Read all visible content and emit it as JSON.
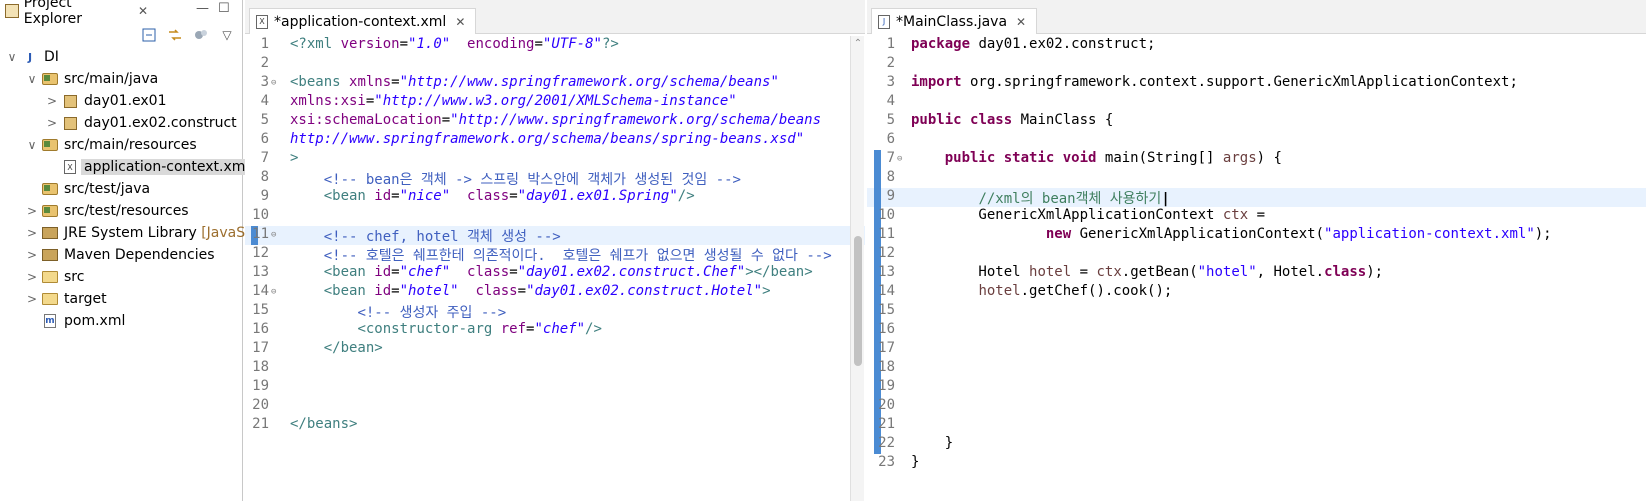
{
  "explorer": {
    "tab_label": "Project Explorer",
    "close_glyph": "✕",
    "minimize_glyph": "—",
    "maximize_glyph": "☐",
    "toolbar": {
      "collapse_all_icon": "collapse-all-icon",
      "link_editor_icon": "link-with-editor-icon",
      "filters_icon": "filters-icon",
      "menu_icon": "view-menu-icon",
      "menu_glyph": "▽"
    },
    "tree": [
      {
        "label": "DI",
        "icon": "project-icon",
        "arrow": "∨"
      },
      {
        "label": "src/main/java",
        "icon": "source-folder-icon",
        "arrow": "∨"
      },
      {
        "label": "day01.ex01",
        "icon": "package-icon",
        "arrow": ">"
      },
      {
        "label": "day01.ex02.construct",
        "icon": "package-icon",
        "arrow": ">"
      },
      {
        "label": "src/main/resources",
        "icon": "source-folder-icon",
        "arrow": "∨"
      },
      {
        "label": "application-context.xml",
        "icon": "xml-file-icon",
        "arrow": ""
      },
      {
        "label": "src/test/java",
        "icon": "source-folder-icon",
        "arrow": ""
      },
      {
        "label": "src/test/resources",
        "icon": "source-folder-icon",
        "arrow": ">"
      },
      {
        "label": "JRE System Library",
        "decoration": "[JavaSE-",
        "icon": "library-icon",
        "arrow": ">"
      },
      {
        "label": "Maven Dependencies",
        "icon": "library-icon",
        "arrow": ">"
      },
      {
        "label": "src",
        "icon": "folder-icon",
        "arrow": ">"
      },
      {
        "label": "target",
        "icon": "folder-icon",
        "arrow": ">"
      },
      {
        "label": "pom.xml",
        "icon": "maven-file-icon",
        "arrow": ""
      }
    ]
  },
  "xml_editor": {
    "tab_label": "*application-context.xml",
    "close_glyph": "✕",
    "lines": [
      {
        "n": "1",
        "tokens": [
          [
            "xml-tag",
            "<?xml "
          ],
          [
            "xml-attr",
            "version"
          ],
          [
            "",
            "="
          ],
          [
            "xml-val",
            "\"1.0\""
          ],
          [
            "",
            "  "
          ],
          [
            "xml-attr",
            "encoding"
          ],
          [
            "",
            "="
          ],
          [
            "xml-val",
            "\"UTF-8\""
          ],
          [
            "xml-tag",
            "?>"
          ]
        ]
      },
      {
        "n": "2",
        "tokens": []
      },
      {
        "n": "3",
        "fold": true,
        "tokens": [
          [
            "xml-tag",
            "<beans "
          ],
          [
            "xml-attr",
            "xmlns"
          ],
          [
            "",
            "="
          ],
          [
            "xml-val",
            "\"http://www.springframework.org/schema/beans\""
          ]
        ]
      },
      {
        "n": "4",
        "tokens": [
          [
            "xml-attr",
            "xmlns:xsi"
          ],
          [
            "",
            "="
          ],
          [
            "xml-val",
            "\"http://www.w3.org/2001/XMLSchema-instance\""
          ]
        ]
      },
      {
        "n": "5",
        "tokens": [
          [
            "xml-attr",
            "xsi:schemaLocation"
          ],
          [
            "",
            "="
          ],
          [
            "xml-val",
            "\"http://www.springframework.org/schema/beans"
          ]
        ]
      },
      {
        "n": "6",
        "tokens": [
          [
            "xml-val",
            "http://www.springframework.org/schema/beans/spring-beans.xsd\""
          ]
        ]
      },
      {
        "n": "7",
        "tokens": [
          [
            "xml-tag",
            ">"
          ]
        ]
      },
      {
        "n": "8",
        "tokens": [
          [
            "",
            "    "
          ],
          [
            "xml-cmt",
            "<!-- bean은 객체 -> 스프링 박스안에 객체가 생성된 것임 -->"
          ]
        ]
      },
      {
        "n": "9",
        "tokens": [
          [
            "",
            "    "
          ],
          [
            "xml-tag",
            "<bean "
          ],
          [
            "xml-attr",
            "id"
          ],
          [
            "",
            "="
          ],
          [
            "xml-val",
            "\"nice\""
          ],
          [
            "",
            "  "
          ],
          [
            "xml-attr",
            "class"
          ],
          [
            "",
            "="
          ],
          [
            "xml-val",
            "\"day01.ex01.Spring\""
          ],
          [
            "xml-tag",
            "/>"
          ]
        ]
      },
      {
        "n": "10",
        "tokens": []
      },
      {
        "n": "11",
        "fold": true,
        "current": true,
        "tokens": [
          [
            "",
            "    "
          ],
          [
            "xml-cmt",
            "<!-- chef, hotel 객체 생성 -->"
          ]
        ]
      },
      {
        "n": "12",
        "tokens": [
          [
            "",
            "    "
          ],
          [
            "xml-cmt",
            "<!-- 호텔은 쉐프한테 의존적이다.  호텔은 쉐프가 없으면 생성될 수 없다 -->"
          ]
        ]
      },
      {
        "n": "13",
        "tokens": [
          [
            "",
            "    "
          ],
          [
            "xml-tag",
            "<bean "
          ],
          [
            "xml-attr",
            "id"
          ],
          [
            "",
            "="
          ],
          [
            "xml-val",
            "\"chef\""
          ],
          [
            "",
            "  "
          ],
          [
            "xml-attr",
            "class"
          ],
          [
            "",
            "="
          ],
          [
            "xml-val",
            "\"day01.ex02.construct.Chef\""
          ],
          [
            "xml-tag",
            "></bean>"
          ]
        ]
      },
      {
        "n": "14",
        "fold": true,
        "tokens": [
          [
            "",
            "    "
          ],
          [
            "xml-tag",
            "<bean "
          ],
          [
            "xml-attr",
            "id"
          ],
          [
            "",
            "="
          ],
          [
            "xml-val",
            "\"hotel\""
          ],
          [
            "",
            "  "
          ],
          [
            "xml-attr",
            "class"
          ],
          [
            "",
            "="
          ],
          [
            "xml-val",
            "\"day01.ex02.construct.Hotel\""
          ],
          [
            "xml-tag",
            ">"
          ]
        ]
      },
      {
        "n": "15",
        "tokens": [
          [
            "",
            "        "
          ],
          [
            "xml-cmt",
            "<!-- 생성자 주입 -->"
          ]
        ]
      },
      {
        "n": "16",
        "tokens": [
          [
            "",
            "        "
          ],
          [
            "xml-tag",
            "<constructor-arg "
          ],
          [
            "xml-attr",
            "ref"
          ],
          [
            "",
            "="
          ],
          [
            "xml-val",
            "\"chef\""
          ],
          [
            "xml-tag",
            "/>"
          ]
        ]
      },
      {
        "n": "17",
        "tokens": [
          [
            "",
            "    "
          ],
          [
            "xml-tag",
            "</bean>"
          ]
        ]
      },
      {
        "n": "18",
        "tokens": []
      },
      {
        "n": "19",
        "tokens": []
      },
      {
        "n": "20",
        "tokens": []
      },
      {
        "n": "21",
        "tokens": [
          [
            "xml-tag",
            "</beans>"
          ]
        ]
      }
    ]
  },
  "java_editor": {
    "tab_label": "*MainClass.java",
    "close_glyph": "✕",
    "lines": [
      {
        "n": "1",
        "tokens": [
          [
            "j-kw",
            "package"
          ],
          [
            "",
            " day01.ex02.construct;"
          ]
        ]
      },
      {
        "n": "2",
        "tokens": []
      },
      {
        "n": "3",
        "tokens": [
          [
            "j-kw",
            "import"
          ],
          [
            "",
            " org.springframework.context.support.GenericXmlApplicationContext;"
          ]
        ]
      },
      {
        "n": "4",
        "tokens": []
      },
      {
        "n": "5",
        "tokens": [
          [
            "j-kw",
            "public"
          ],
          [
            "",
            " "
          ],
          [
            "j-kw",
            "class"
          ],
          [
            "",
            " MainClass {"
          ]
        ]
      },
      {
        "n": "6",
        "tokens": []
      },
      {
        "n": "7",
        "fold": true,
        "tokens": [
          [
            "",
            "    "
          ],
          [
            "j-kw",
            "public"
          ],
          [
            "",
            " "
          ],
          [
            "j-kw",
            "static"
          ],
          [
            "",
            " "
          ],
          [
            "j-kw",
            "void"
          ],
          [
            "",
            " main(String[] "
          ],
          [
            "j-var",
            "args"
          ],
          [
            "",
            ") {"
          ]
        ]
      },
      {
        "n": "8",
        "tokens": []
      },
      {
        "n": "9",
        "current": true,
        "tokens": [
          [
            "",
            "        "
          ],
          [
            "j-cmt",
            "//xml의 bean객체 사용하기"
          ]
        ]
      },
      {
        "n": "10",
        "warning": true,
        "tokens": [
          [
            "",
            "        GenericXmlApplicationContext "
          ],
          [
            "j-var",
            "ctx"
          ],
          [
            "",
            " ="
          ]
        ]
      },
      {
        "n": "11",
        "tokens": [
          [
            "",
            "                "
          ],
          [
            "j-kw",
            "new"
          ],
          [
            "",
            " GenericXmlApplicationContext("
          ],
          [
            "j-str",
            "\"application-context.xml\""
          ],
          [
            "",
            ");"
          ]
        ]
      },
      {
        "n": "12",
        "tokens": []
      },
      {
        "n": "13",
        "tokens": [
          [
            "",
            "        Hotel "
          ],
          [
            "j-var",
            "hotel"
          ],
          [
            "",
            " = "
          ],
          [
            "j-var",
            "ctx"
          ],
          [
            "",
            ".getBean("
          ],
          [
            "j-str",
            "\"hotel\""
          ],
          [
            "",
            ", Hotel."
          ],
          [
            "j-kw",
            "class"
          ],
          [
            "",
            ");"
          ]
        ]
      },
      {
        "n": "14",
        "tokens": [
          [
            "",
            "        "
          ],
          [
            "j-var",
            "hotel"
          ],
          [
            "",
            ".getChef().cook();"
          ]
        ]
      },
      {
        "n": "15",
        "tokens": []
      },
      {
        "n": "16",
        "tokens": []
      },
      {
        "n": "17",
        "tokens": []
      },
      {
        "n": "18",
        "tokens": []
      },
      {
        "n": "19",
        "tokens": []
      },
      {
        "n": "20",
        "tokens": []
      },
      {
        "n": "21",
        "tokens": []
      },
      {
        "n": "22",
        "tokens": [
          [
            "",
            "    }"
          ]
        ]
      },
      {
        "n": "23",
        "tokens": [
          [
            "",
            "}"
          ]
        ]
      }
    ]
  }
}
